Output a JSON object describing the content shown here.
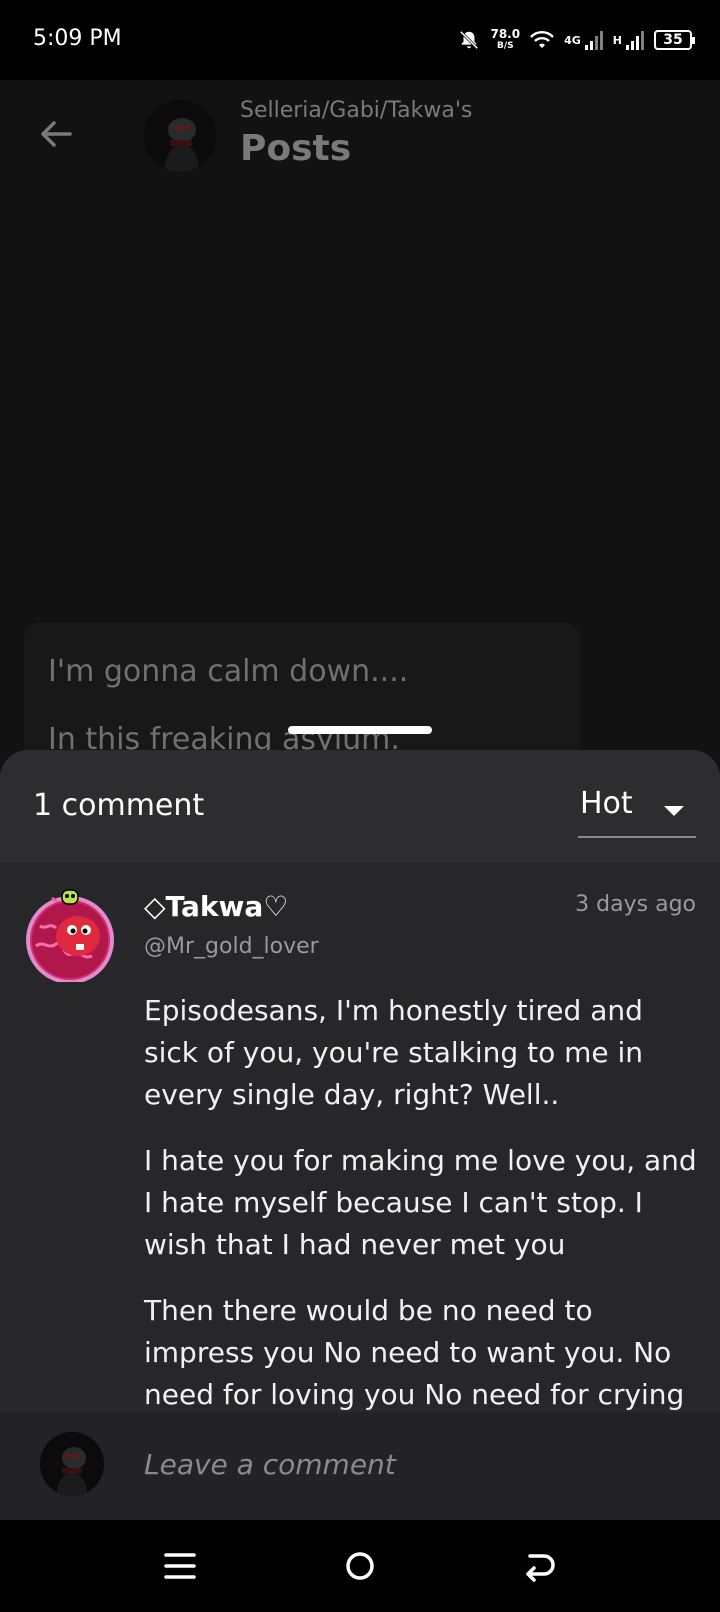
{
  "status_bar": {
    "time": "5:09 PM",
    "net_speed": "78.0",
    "net_unit": "B/S",
    "net_type_1": "4G",
    "net_type_2": "H",
    "battery": "35"
  },
  "header": {
    "subtitle": "Selleria/Gabi/Takwa's",
    "title": "Posts"
  },
  "post_preview": {
    "line1": "I'm gonna calm down....",
    "line2": "In this freaking asylum."
  },
  "comments_sheet": {
    "count_label": "1 comment",
    "sort_label": "Hot",
    "comments": [
      {
        "name": "◇Takwa♡",
        "handle": "@Mr_gold_lover",
        "time": "3 days ago",
        "paragraphs": [
          "Episodesans, I'm honestly tired and sick of you, you're stalking to me in every single day, right? Well..",
          "I hate you for making me love you, and I hate myself because I can't stop. I wish that I had never met you",
          "Then there would be no need to impress you No need to want you. No need for loving you No need for crying"
        ]
      }
    ]
  },
  "comment_input": {
    "placeholder": "Leave a comment"
  },
  "colors": {
    "background": "#121212",
    "sheet": "#2a2a2c",
    "avatar_ring": "#e55ab5",
    "avatar_face": "#e0283e"
  }
}
